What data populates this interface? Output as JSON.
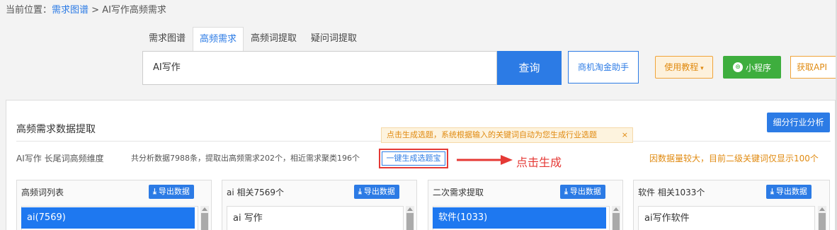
{
  "breadcrumb": {
    "prefix": "当前位置：",
    "link": "需求图谱",
    "separator": " > ",
    "current": "AI写作高频需求"
  },
  "tabs": [
    {
      "label": "需求图谱",
      "active": false
    },
    {
      "label": "高频需求",
      "active": true
    },
    {
      "label": "高频词提取",
      "active": false
    },
    {
      "label": "疑问词提取",
      "active": false
    }
  ],
  "search": {
    "value": "AI写作",
    "button_label": "查询"
  },
  "toolbar": {
    "assistant_label": "商机淘金助手",
    "tutorial_label": "使用教程",
    "mini_program_label": "小程序",
    "api_label": "获取API"
  },
  "panel": {
    "title": "高频需求数据提取",
    "industry_button": "细分行业分析",
    "tooltip": "点击生成选题，系统根据输入的关键词自动为您生成行业选题",
    "tooltip_close": "×",
    "dimension_label": "AI写作 长尾词高频维度",
    "stats": "共分析数据7988条，提取出高频需求202个，相近需求聚类196个",
    "generate_button": "一键生成选题宝",
    "click_hint": "点击生成",
    "notice": "因数据量较大，目前二级关键词仅显示100个"
  },
  "columns": [
    {
      "title": "高频词列表",
      "export_label": "导出数据",
      "first_item": "ai(7569)",
      "selected": true
    },
    {
      "title": "ai 相关7569个",
      "export_label": "导出数据",
      "first_item": "ai 写作",
      "selected": false
    },
    {
      "title": "二次需求提取",
      "export_label": "导出数据",
      "first_item": "软件(1033)",
      "selected": true
    },
    {
      "title": "软件 相关1033个",
      "export_label": "导出数据",
      "first_item": "ai写作软件",
      "selected": false
    }
  ],
  "colors": {
    "primary": "#2c7be5",
    "selected": "#1e78f0",
    "orange": "#e08a10",
    "green": "#3eae3e",
    "red": "#e53935"
  }
}
